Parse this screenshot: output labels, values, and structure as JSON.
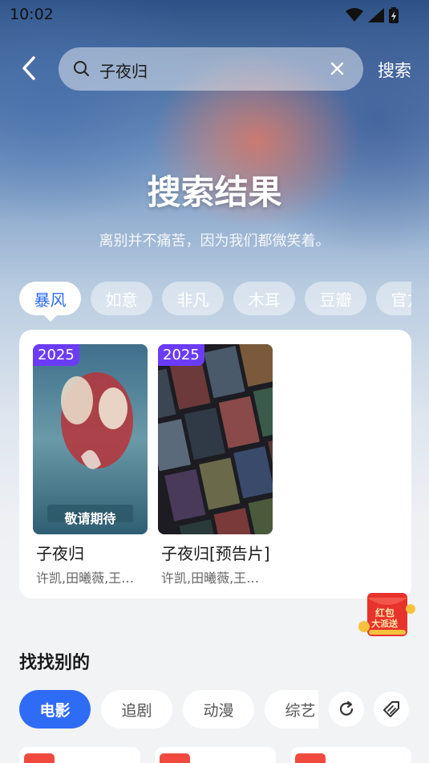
{
  "status_bar": {
    "time": "10:02"
  },
  "search": {
    "query": "子夜归",
    "submit_label": "搜索"
  },
  "hero": {
    "title": "搜索结果",
    "subtitle": "离别并不痛苦，因为我们都微笑着。"
  },
  "sources": [
    "暴风",
    "如意",
    "非凡",
    "木耳",
    "豆瓣",
    "官方"
  ],
  "results": [
    {
      "year": "2025",
      "title": "子夜归",
      "cast": "许凯,田曦薇,王…",
      "poster_text": "敬请期待"
    },
    {
      "year": "2025",
      "title": "子夜归[预告片]",
      "cast": "许凯,田曦薇,王…"
    }
  ],
  "promo": {
    "line1": "红包",
    "line2": "大派送"
  },
  "discover": {
    "title": "找找别的",
    "categories": [
      "电影",
      "追剧",
      "动漫",
      "综艺"
    ]
  },
  "colors": {
    "accent": "#2f6cf6",
    "year_badge": "#6b3cf6",
    "hot_badge": "#f04a3e"
  }
}
